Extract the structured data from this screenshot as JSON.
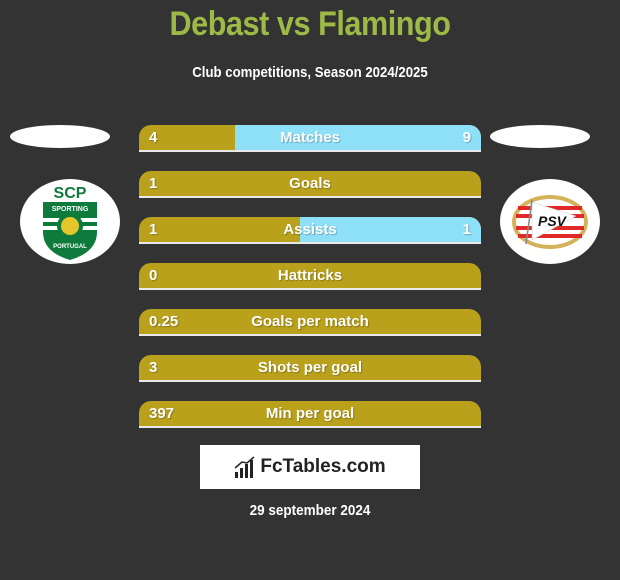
{
  "header": {
    "title": "Debast vs Flamingo",
    "subtitle": "Club competitions, Season 2024/2025"
  },
  "teams": {
    "left": {
      "name": "Sporting CP",
      "logo_icon": "sporting-cp-crest-icon",
      "logo_text": "SCP"
    },
    "right": {
      "name": "PSV",
      "logo_icon": "psv-crest-icon",
      "logo_text": "PSV"
    }
  },
  "colors": {
    "left_bar": "#b9a11b",
    "right_bar": "#8ee0f9",
    "title": "#9dba46",
    "background": "#333333"
  },
  "stats": [
    {
      "label": "Matches",
      "left": "4",
      "right": "9",
      "right_share": 0.72
    },
    {
      "label": "Goals",
      "left": "1",
      "right": "",
      "right_share": 0
    },
    {
      "label": "Assists",
      "left": "1",
      "right": "1",
      "right_share": 0.53
    },
    {
      "label": "Hattricks",
      "left": "0",
      "right": "",
      "right_share": 0
    },
    {
      "label": "Goals per match",
      "left": "0.25",
      "right": "",
      "right_share": 0
    },
    {
      "label": "Shots per goal",
      "left": "3",
      "right": "",
      "right_share": 0
    },
    {
      "label": "Min per goal",
      "left": "397",
      "right": "",
      "right_share": 0
    }
  ],
  "brand": {
    "text": "FcTables.com",
    "icon": "bar-chart-icon"
  },
  "footer": {
    "date": "29 september 2024"
  }
}
